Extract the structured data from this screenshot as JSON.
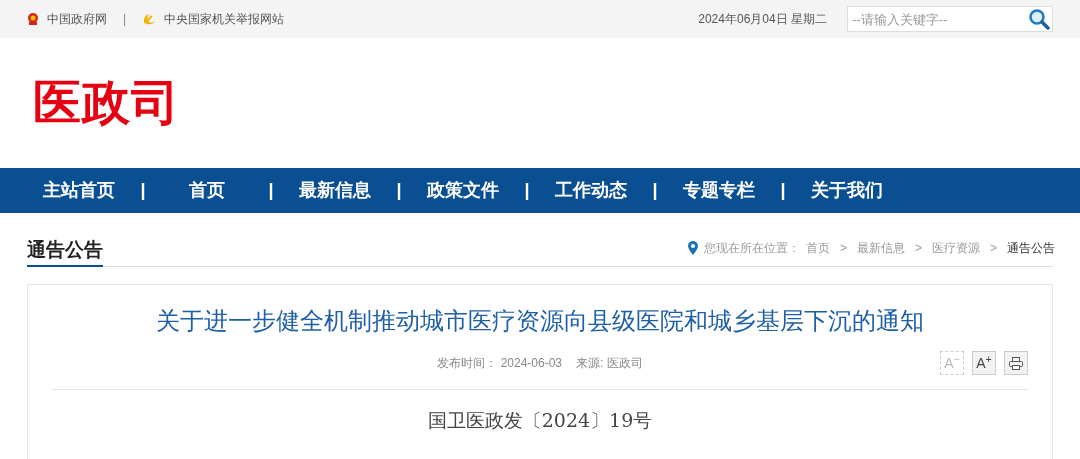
{
  "top_bar": {
    "links": [
      {
        "label": "中国政府网"
      },
      {
        "label": "中央国家机关举报网站"
      }
    ],
    "link_separator": "|",
    "date": "2024年06月04日 星期二",
    "search": {
      "placeholder": "--请输入关键字--"
    }
  },
  "header": {
    "logo": "医政司"
  },
  "nav": {
    "items": [
      {
        "label": "主站首页",
        "separator_after": "|"
      },
      {
        "label": "首页",
        "separator_after": "|"
      },
      {
        "label": "最新信息",
        "separator_after": "|"
      },
      {
        "label": "政策文件",
        "separator_after": "|"
      },
      {
        "label": "工作动态",
        "separator_after": "|"
      },
      {
        "label": "专题专栏",
        "separator_after": "|"
      },
      {
        "label": "关于我们"
      }
    ]
  },
  "section": {
    "title": "通告公告",
    "breadcrumb": {
      "label": "您现在所在位置：",
      "items": [
        {
          "label": "首页",
          "current": false
        },
        {
          "label": "最新信息",
          "current": false
        },
        {
          "label": "医疗资源",
          "current": false
        },
        {
          "label": "通告公告",
          "current": true
        }
      ],
      "separator": ">"
    }
  },
  "article": {
    "title": "关于进一步健全机制推动城市医疗资源向县级医院和城乡基层下沉的通知",
    "meta": [
      {
        "label": "发布时间：",
        "value": "2024-06-03"
      },
      {
        "label": "来源:",
        "value": "医政司"
      }
    ],
    "tools": [
      {
        "kind": "font",
        "label": "A$^{−}$",
        "disabled": true
      },
      {
        "kind": "font",
        "label": "A$^{+}$",
        "disabled": false
      },
      {
        "kind": "print",
        "disabled": false
      }
    ],
    "doc_number": "国卫医政发〔2024〕19号"
  }
}
